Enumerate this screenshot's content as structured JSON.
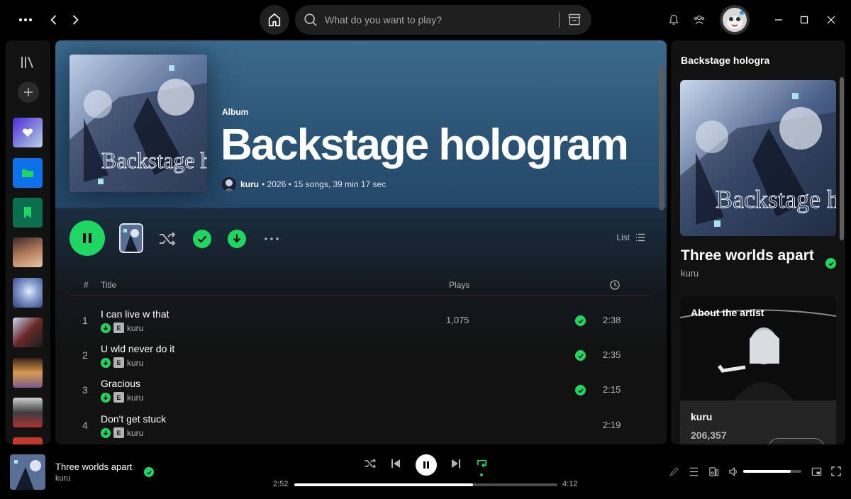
{
  "search": {
    "placeholder": "What do you want to play?"
  },
  "album": {
    "type_label": "Album",
    "title": "Backstage hologram",
    "artist": "kuru",
    "meta": "• 2026 • 15 songs, 39 min 17 sec",
    "cover_text": "Backstage hologram"
  },
  "actions": {
    "view_label": "List"
  },
  "table": {
    "headers": {
      "num": "#",
      "title": "Title",
      "plays": "Plays"
    },
    "rows": [
      {
        "num": "1",
        "title": "I can live w that",
        "artist": "kuru",
        "explicit": "E",
        "plays": "1,075",
        "saved": true,
        "duration": "2:38"
      },
      {
        "num": "2",
        "title": "U wld never do it",
        "artist": "kuru",
        "explicit": "E",
        "plays": "",
        "saved": true,
        "duration": "2:35"
      },
      {
        "num": "3",
        "title": "Gracious",
        "artist": "kuru",
        "explicit": "E",
        "plays": "",
        "saved": true,
        "duration": "2:15"
      },
      {
        "num": "4",
        "title": "Don't get stuck",
        "artist": "kuru",
        "explicit": "E",
        "plays": "",
        "saved": false,
        "duration": "2:19"
      }
    ]
  },
  "right_panel": {
    "header": "Backstage hologra",
    "track_title": "Three worlds apart",
    "track_artist": "kuru",
    "about_label": "About the artist",
    "artist_name": "kuru",
    "monthly_listeners": "206,357"
  },
  "player": {
    "title": "Three worlds apart",
    "artist": "kuru",
    "elapsed": "2:52",
    "total": "4:12",
    "progress": 0.68,
    "volume": 0.82
  },
  "colors": {
    "accent": "#1ed760",
    "hero": "#2f5a7c"
  }
}
